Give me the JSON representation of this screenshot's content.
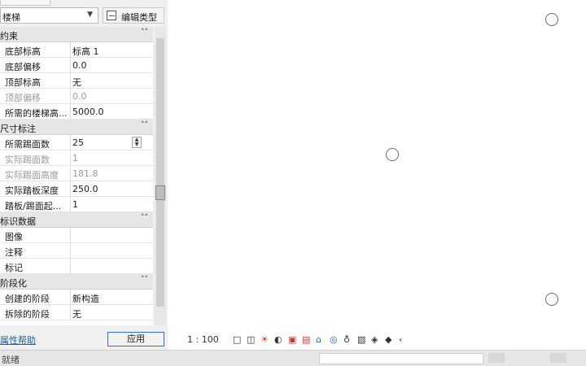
{
  "panel": {
    "type_selector": "楼梯",
    "edit_type_label": "编辑类型",
    "help_link": "属性帮助",
    "apply_label": "应用"
  },
  "categories": [
    {
      "name": "约束",
      "rows": [
        {
          "name": "底部标高",
          "value": "标高 1",
          "disabled": false
        },
        {
          "name": "底部偏移",
          "value": "0.0",
          "disabled": false
        },
        {
          "name": "顶部标高",
          "value": "无",
          "disabled": false
        },
        {
          "name": "顶部偏移",
          "value": "0.0",
          "disabled": true
        },
        {
          "name": "所需的楼梯高...",
          "value": "5000.0",
          "disabled": false
        }
      ]
    },
    {
      "name": "尺寸标注",
      "rows": [
        {
          "name": "所需踢面数",
          "value": "25",
          "disabled": false
        },
        {
          "name": "实际踢面数",
          "value": "1",
          "disabled": true
        },
        {
          "name": "实际踢面高度",
          "value": "181.8",
          "disabled": true
        },
        {
          "name": "实际踏板深度",
          "value": "250.0",
          "disabled": false
        },
        {
          "name": "踏板/踢面起...",
          "value": "1",
          "disabled": false
        }
      ]
    },
    {
      "name": "标识数据",
      "rows": [
        {
          "name": "图像",
          "value": "",
          "disabled": false
        },
        {
          "name": "注释",
          "value": "",
          "disabled": false
        },
        {
          "name": "标记",
          "value": "",
          "disabled": false
        }
      ]
    },
    {
      "name": "阶段化",
      "rows": [
        {
          "name": "创建的阶段",
          "value": "新构造",
          "disabled": false
        },
        {
          "name": "拆除的阶段",
          "value": "无",
          "disabled": false
        }
      ]
    }
  ],
  "view_bar": {
    "scale": "1 : 100",
    "icons": [
      "detail-level-icon",
      "visual-style-icon",
      "sun-path-icon",
      "shadows-icon",
      "crop-view-icon",
      "show-crop-icon",
      "unlock-3d-icon",
      "temporary-hide-icon",
      "reveal-hidden-icon",
      "analytical-model-icon",
      "highlight-displacement-icon",
      "constraints-icon",
      "collapse-arrow-icon"
    ]
  },
  "status_bar": {
    "text": "就绪"
  }
}
